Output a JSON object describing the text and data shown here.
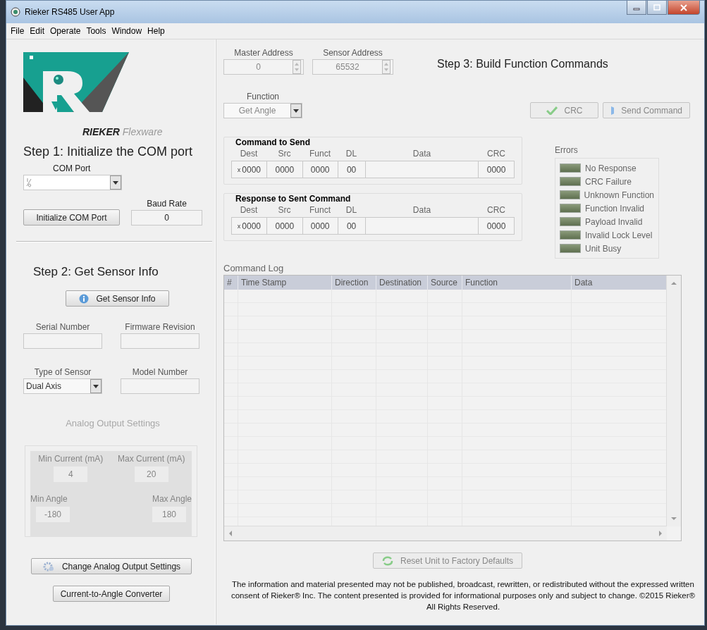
{
  "window": {
    "title": "Rieker RS485 User App"
  },
  "menu": [
    "File",
    "Edit",
    "Operate",
    "Tools",
    "Window",
    "Help"
  ],
  "logo": {
    "brand": "RIEKER",
    "product": "Flexware"
  },
  "step1": {
    "title": "Step 1: Initialize the COM port",
    "com_port": {
      "label": "COM Port"
    },
    "initialize_button": {
      "label": "Initialize COM Port",
      "disabled": false
    },
    "baud_rate": {
      "label": "Baud Rate",
      "value": "0"
    }
  },
  "step2": {
    "title": "Step 2: Get Sensor Info",
    "get_info_button": {
      "label": "Get Sensor Info",
      "disabled": false
    },
    "fields": [
      {
        "label": "Serial Number",
        "kind": "text"
      },
      {
        "label": "Firmware Revision",
        "kind": "text"
      },
      {
        "label": "Type of Sensor",
        "kind": "dropdown",
        "value": "Dual Axis"
      },
      {
        "label": "Model Number",
        "kind": "text"
      }
    ],
    "analog_output": {
      "title": "Analog Output Settings",
      "disabled": true,
      "fields": [
        {
          "label": "Min Current (mA)",
          "value": "4"
        },
        {
          "label": "Max Current (mA)",
          "value": "20"
        },
        {
          "label": "Min Angle",
          "value": "-180"
        },
        {
          "label": "Max Angle",
          "value": "180"
        }
      ]
    },
    "buttons": [
      {
        "label": "Change Analog Output Settings",
        "kind": "icon",
        "disabled": false
      },
      {
        "label": "Current-to-Angle Converter",
        "kind": "plain",
        "disabled": false
      }
    ]
  },
  "step3": {
    "title": "Step 3: Build Function Commands",
    "master_address": {
      "label": "Master Address",
      "value": "0",
      "disabled": true
    },
    "sensor_address": {
      "label": "Sensor Address",
      "value": "65532",
      "disabled": true
    },
    "function": {
      "label": "Function",
      "value": "Get Angle",
      "disabled": true
    },
    "crc_button": {
      "label": "CRC",
      "disabled": true
    },
    "send_button": {
      "label": "Send Command",
      "disabled": true
    },
    "packets": [
      {
        "title": "Command to Send",
        "radix": "x",
        "cells": [
          {
            "column": "Dest",
            "value": "0000"
          },
          {
            "column": "Src",
            "value": "0000"
          },
          {
            "column": "Funct",
            "value": "0000"
          },
          {
            "column": "DL",
            "value": "00"
          },
          {
            "column": "Data"
          },
          {
            "column": "CRC",
            "value": "0000"
          }
        ]
      },
      {
        "title": "Response to Sent Command",
        "radix": "x",
        "cells": [
          {
            "column": "Dest",
            "value": "0000"
          },
          {
            "column": "Src",
            "value": "0000"
          },
          {
            "column": "Funct",
            "value": "0000"
          },
          {
            "column": "DL",
            "value": "00"
          },
          {
            "column": "Data"
          },
          {
            "column": "CRC",
            "value": "0000"
          }
        ]
      }
    ],
    "errors": {
      "label": "Errors",
      "items": [
        {
          "label": "No Response",
          "on": false
        },
        {
          "label": "CRC Failure",
          "on": false
        },
        {
          "label": "Unknown Function",
          "on": false
        },
        {
          "label": "Function Invalid",
          "on": false
        },
        {
          "label": "Payload Invalid",
          "on": false
        },
        {
          "label": "Invalid Lock Level",
          "on": false
        },
        {
          "label": "Unit Busy",
          "on": false
        }
      ]
    },
    "command_log": {
      "label": "Command Log",
      "columns": [
        "#",
        "Time Stamp",
        "Direction",
        "Destination",
        "Source",
        "Function",
        "Data"
      ]
    },
    "reset_button": {
      "label": "Reset Unit to Factory Defaults",
      "disabled": true
    },
    "footer": "The information and material presented may not be published, broadcast, rewritten, or redistributed without the expressed written consent of Rieker® Inc. The content presented is provided for informational purposes only and subject to change. ©2015 Rieker® All Rights Reserved."
  }
}
